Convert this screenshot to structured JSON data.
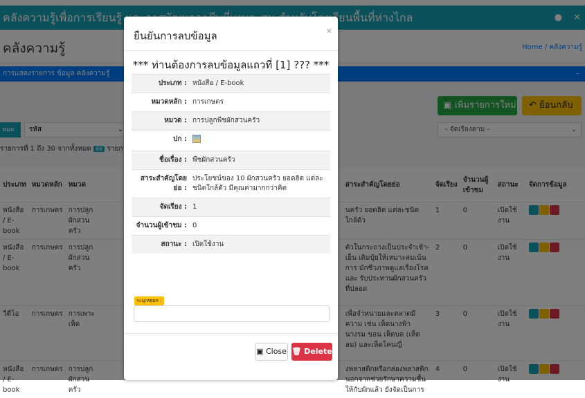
{
  "topbar": {
    "title": "คลังความรู้เพื่อการเรียนรู้ และการพัฒนาอาชีพที่เหมาะสม สำหรับโรงเรียนพื้นที่ห่างไกล",
    "user_icon": "user-icon",
    "close_icon": "close-icon"
  },
  "header": {
    "title": "คลังความรู้",
    "breadcrumb": "Home / คลังความรู้"
  },
  "notice": {
    "text": "การแสดงรายการ ข้อมูล คลังความรู้",
    "dash": "–"
  },
  "toolbar": {
    "add_label": "เพิ่มรายการใหม่",
    "back_label": "ย้อนกลับ"
  },
  "filters": {
    "pill": "หมด",
    "sort_value": "รหัส",
    "order_value": "- จัดเรียงตาม -"
  },
  "info": {
    "text": "รายการที่ 1 ถึง 30 จากทั้งหมด",
    "count": "88",
    "suffix": "รายการ"
  },
  "table": {
    "headers": [
      "ประเภท",
      "หมวดหลัก",
      "หมวด",
      "",
      "สาระสำคัญโดยย่อ",
      "จัดเรียง",
      "จำนวนผู้เข้าชม",
      "สถานะ",
      "จัดการข้อมูล"
    ],
    "rows": [
      {
        "type": "หนังสือ / E-book",
        "main": "การเกษตร",
        "cat": "การปลูกผักสวนครัว",
        "summary": "นครัว ยอดฮิต แต่ละชนิดใกล้ตัว",
        "order": "1",
        "views": "0",
        "status": "เปิดใช้งาน"
      },
      {
        "type": "หนังสือ / E-book",
        "main": "การเกษตร",
        "cat": "การปลูกผักสวนครัว",
        "summary": "ตัวในกระถางเป็นประจำเช้า-เย็น เติมปุ๋ยให้เหมาะสมเน้นการ มักชีวภาพดูแลเรื่องโรคและ รับประทานผักสวนครัวที่ปลอด",
        "order": "2",
        "views": "0",
        "status": "เปิดใช้งาน"
      },
      {
        "type": "วีดีโอ",
        "main": "การเกษตร",
        "cat": "การเพาะเห็ด",
        "summary": "เพื่อจำหน่ายและตลาดมีความ เช่น เห็ดนางฟ้า นางรม ขอน เห็ดบด (เห็ดลม) และเห็ดโคนญี่",
        "order": "3",
        "views": "0",
        "status": "เปิดใช้งาน"
      },
      {
        "type": "หนังสือ / E-book",
        "main": "การเกษตร",
        "cat": "การปลูกผักสวนครัว",
        "summary": "งพลาสติกหรือกล่องพลาสติก นอกจากช่วยรักษาความชื้นให้กับผักแล้ว ยังจัดเป็นการ",
        "order": "4",
        "views": "0",
        "status": "เปิดใช้งาน"
      }
    ]
  },
  "modal": {
    "title": "ยืนยันการลบข้อมูล",
    "close_x": "×",
    "heading": "*** ท่านต้องการลบข้อมูลแถวที่ [1] ??? ***",
    "fields": [
      {
        "label": "ประเภท :",
        "value": "หนังสือ / E-book"
      },
      {
        "label": "หมวดหลัก :",
        "value": "การเกษตร"
      },
      {
        "label": "หมวด :",
        "value": "การปลูกพืชผักสวนครัว"
      },
      {
        "label": "ปก :",
        "value": ""
      },
      {
        "label": "ชื่อเรื่อง :",
        "value": "พืชผักสวนครัว"
      },
      {
        "label": "สาระสำคัญโดยย่อ :",
        "value": "ประโยชน์ของ 10 ผักสวนครัว ยอดฮิต แต่ละชนิดใกล้ตัว มีคุณค่ามากกว่าคิด"
      },
      {
        "label": "จัดเรียง :",
        "value": "1"
      },
      {
        "label": "จำนวนผู้เข้าชม :",
        "value": "0"
      },
      {
        "label": "สถานะ :",
        "value": "เปิดใช้งาน"
      }
    ],
    "reason_label": "ระบุเหตุผล :",
    "reason_value": "",
    "close_label": "Close",
    "delete_label": "Delete"
  }
}
